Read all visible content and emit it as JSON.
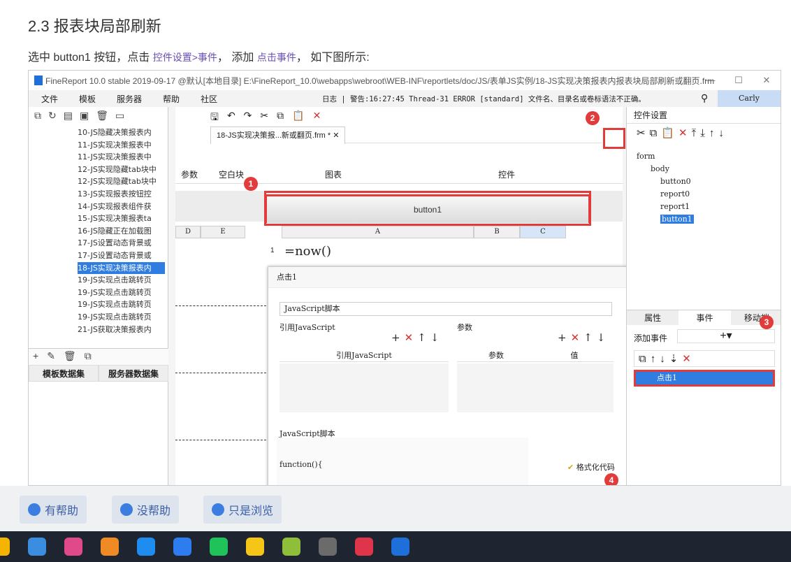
{
  "doc": {
    "title": "2.3 报表块局部刷新",
    "line_pre": "选中 button1 按钮，点击 ",
    "link1": "控件设置>事件",
    "line_mid": "， 添加 ",
    "link2": "点击事件",
    "line_post": "， 如下图所示:"
  },
  "window": {
    "title": "FineReport 10.0 stable 2019-09-17 @默认[本地目录]   E:\\FineReport_10.0\\webapps\\webroot\\WEB-INF\\reportlets/doc/JS/表单JS实例/18-JS实现决策报表内报表块局部刷新或翻页.frm",
    "minimize": "—",
    "maximize": "☐",
    "close": "✕"
  },
  "menu": {
    "items": [
      "文件",
      "模板",
      "服务器",
      "帮助",
      "社区"
    ],
    "log": "日志 | 警告:16:27:45 Thread-31 ERROR [standard] 文件名、目录名或卷标语法不正确。",
    "user": "Carly"
  },
  "tree": {
    "items": [
      "10-JS隐藏决策报表内",
      "11-JS实现决策报表中",
      "11-JS实现决策报表中",
      "12-JS实现隐藏tab块中",
      "12-JS实现隐藏tab块中",
      "13-JS实现报表按钮控",
      "14-JS实现报表组件获",
      "15-JS实现决策报表ta",
      "16-JS隐藏正在加载图",
      "17-JS设置动态背景或",
      "17-JS设置动态背景或",
      "18-JS实现决策报表内",
      "19-JS实现点击跳转页",
      "19-JS实现点击跳转页",
      "19-JS实现点击跳转页",
      "19-JS实现点击跳转页",
      "21-JS获取决策报表内"
    ],
    "selected_index": 11
  },
  "left_tabs": [
    "模板数据集",
    "服务器数据集"
  ],
  "center": {
    "file_tab": "18-JS实现决策报...新或翻页.frm * ✕",
    "ribbon_labels": [
      "参数",
      "空白块",
      "图表",
      "控件"
    ],
    "button_label": "button1",
    "columns": [
      "D",
      "E",
      "A",
      "B",
      "C"
    ],
    "row1": "1",
    "cell_a1": "=now()"
  },
  "dialog": {
    "header": "点击1",
    "select_value": "JavaScript脚本",
    "ref_js_label": "引用JavaScript",
    "param_label": "参数",
    "table_ref": "引用JavaScript",
    "table_param": "参数",
    "table_value": "值",
    "script_label": "JavaScript脚本",
    "format_btn": "格式化代码",
    "code": "function(){"
  },
  "right": {
    "header": "控件设置",
    "components": [
      "form",
      "body",
      "button0",
      "report0",
      "report1",
      "button1"
    ],
    "tabs": [
      "属性",
      "事件",
      "移动端"
    ],
    "add_event": "添加事件",
    "event_item": "点击1"
  },
  "badges": [
    "1",
    "2",
    "3",
    "4"
  ],
  "feedback": {
    "helpful": "有帮助",
    "not_helpful": "没帮助",
    "browse": "只是浏览"
  },
  "colors": {
    "accent": "#2f7de1",
    "highlight": "#e23b3b",
    "link": "#6a4fb6"
  }
}
